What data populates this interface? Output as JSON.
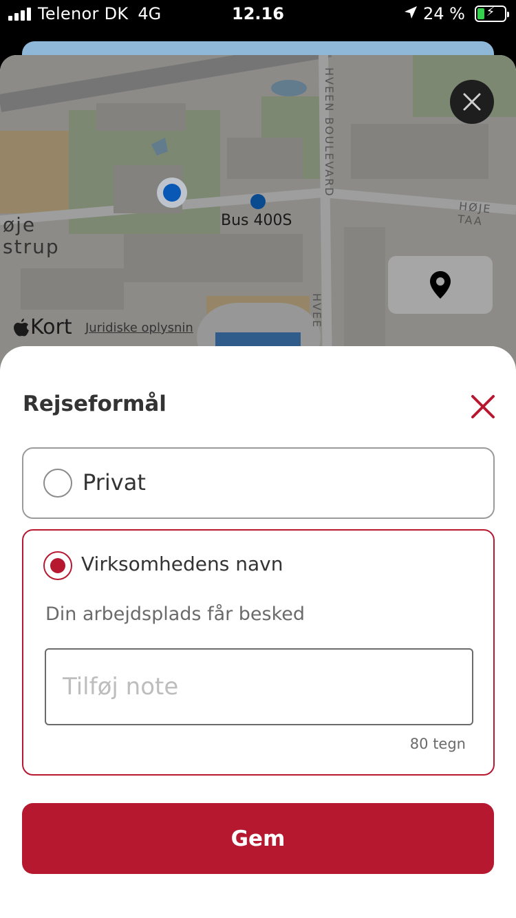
{
  "status_bar": {
    "carrier": "Telenor DK",
    "network": "4G",
    "time": "12.16",
    "battery_percent": "24 %",
    "battery_level": 0.24,
    "battery_color": "#35d04d"
  },
  "map": {
    "place_label_1": "øje",
    "place_label_2": "strup",
    "street_1": "HVEEN BOULEVARD",
    "street_2": "HØJE TAA",
    "street_3": "HVEE",
    "bus_stop_label": "Bus 400S",
    "bus_badge_label": "400S",
    "maps_brand": "Kort",
    "legal_link": "Juridiske oplysnin",
    "icons": {
      "close": "close-icon",
      "locate": "map-pin-icon",
      "brand": "apple-logo-icon"
    }
  },
  "sheet": {
    "title": "Rejseformål",
    "options": [
      {
        "label": "Privat",
        "selected": false
      },
      {
        "label": "Virksomhedens navn",
        "selected": true
      }
    ],
    "helper_text": "Din arbejdsplads får besked",
    "note_placeholder": "Tilføj note",
    "note_value": "",
    "char_limit_label": "80 tegn",
    "save_label": "Gem",
    "accent_color": "#b5182f"
  }
}
